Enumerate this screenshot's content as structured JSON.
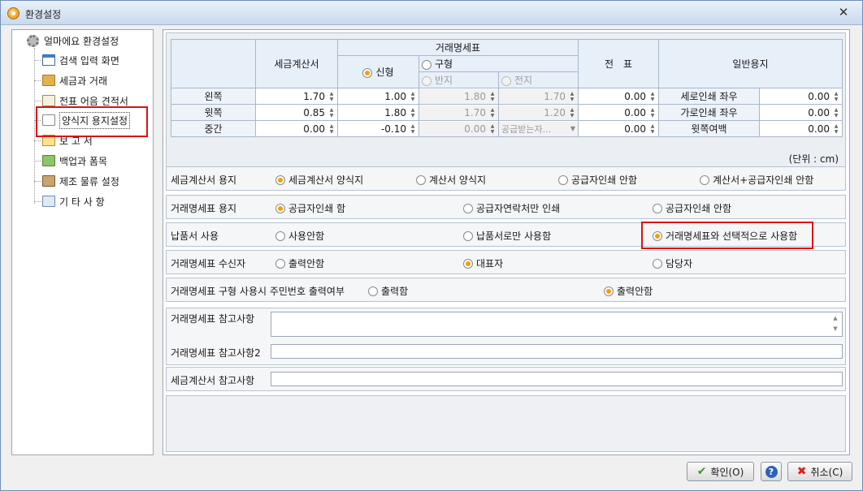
{
  "window": {
    "title": "환경설정",
    "close": "✕"
  },
  "tree": {
    "root": "얼마에요 환경설정",
    "items": [
      "검색 입력 화면",
      "세금과 거래",
      "전표 어음 견적서",
      "양식지 용지설정",
      "보 고 서",
      "백업과 폼목",
      "제조 물류 설정",
      "기 타 사 항"
    ],
    "selected": "양식지 용지설정"
  },
  "grid": {
    "headers": {
      "tax": "세금계산서",
      "trade": "거래명세표",
      "new": "신형",
      "old": "구형",
      "half": "반지",
      "full": "전지",
      "voucher": "전　표",
      "general": "일반용지"
    },
    "rows": [
      {
        "label": "왼쪽",
        "tax": "1.70",
        "trade_new": "1.00",
        "half": "1.80",
        "full": "1.70",
        "voucher": "0.00",
        "glabel": "세로인쇄 좌우",
        "gval": "0.00"
      },
      {
        "label": "윗쪽",
        "tax": "0.85",
        "trade_new": "1.80",
        "half": "1.70",
        "full": "1.20",
        "voucher": "0.00",
        "glabel": "가로인쇄 좌우",
        "gval": "0.00"
      },
      {
        "label": "중간",
        "tax": "0.00",
        "trade_new": "-0.10",
        "half": "0.00",
        "full": "공급받는자...",
        "voucher": "0.00",
        "glabel": "윗쪽여백",
        "gval": "0.00"
      }
    ],
    "unit": "(단위 : cm)"
  },
  "options": [
    {
      "label": "세금계산서 용지",
      "choices": [
        "세금계산서 양식지",
        "계산서 양식지",
        "공급자인쇄 안함",
        "계산서+공급자인쇄 안함"
      ],
      "selected": 0
    },
    {
      "label": "거래명세표 용지",
      "choices": [
        "공급자인쇄 함",
        "공급자연락처만 인쇄",
        "공급자인쇄 안함"
      ],
      "selected": 0
    },
    {
      "label": "납품서 사용",
      "choices": [
        "사용안함",
        "납품서로만 사용함",
        "거래명세표와 선택적으로 사용함"
      ],
      "selected": 2
    },
    {
      "label": "거래명세표 수신자",
      "choices": [
        "출력안함",
        "대표자",
        "담당자"
      ],
      "selected": 1
    },
    {
      "label": "거래명세표 구형 사용시 주민번호 출력여부",
      "choices": [
        "출력함",
        "출력안함"
      ],
      "selected": 1
    }
  ],
  "memo": {
    "trade_note": "거래명세표 참고사항",
    "trade_note2": "거래명세표 참고사항2",
    "tax_note": "세금계산서 참고사항"
  },
  "buttons": {
    "ok": "확인(O)",
    "help": "?",
    "cancel": "취소(C)"
  },
  "colors": {
    "highlight_box": "#dd1111",
    "radio_selected": "#f0a000"
  }
}
